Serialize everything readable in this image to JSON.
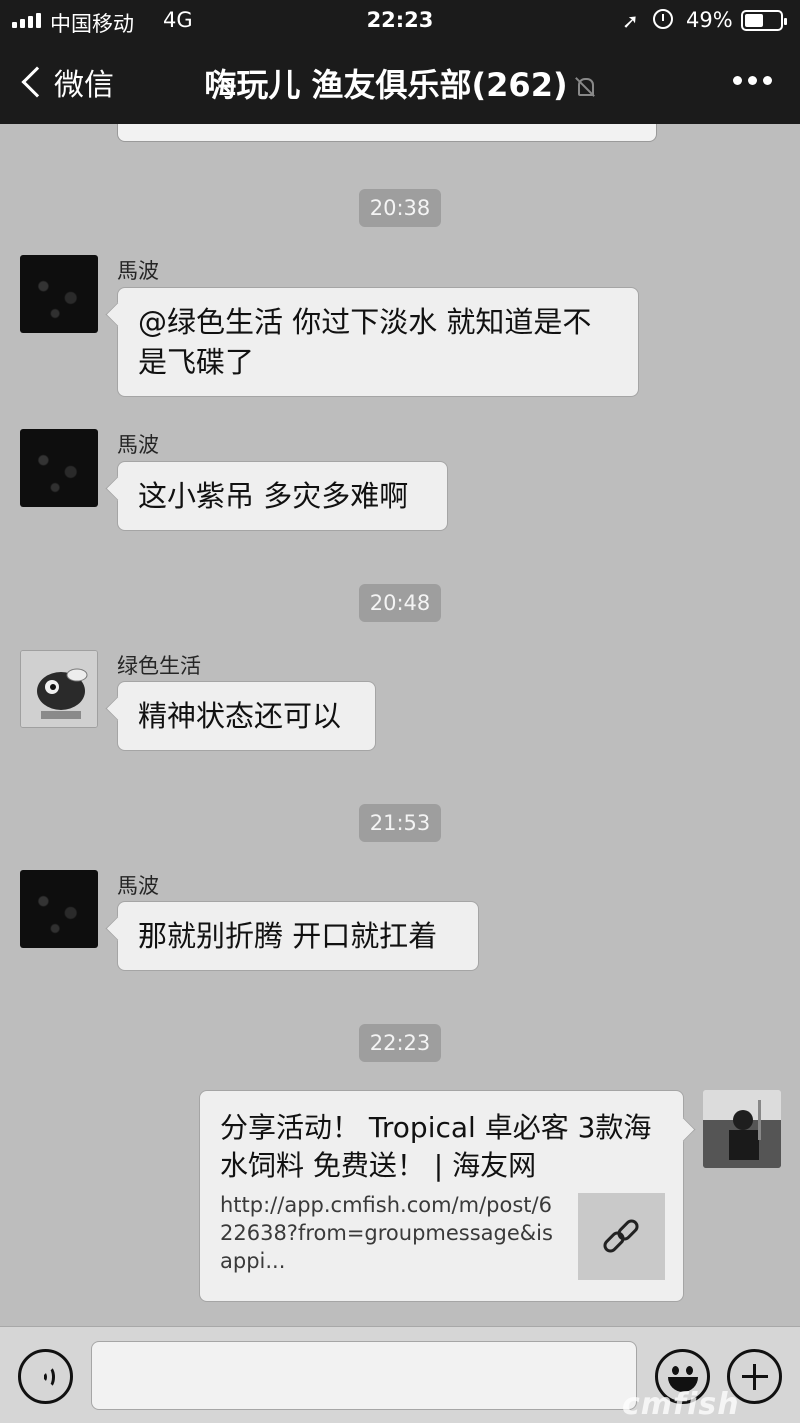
{
  "status_bar": {
    "carrier": "中国移动",
    "network": "4G",
    "time": "22:23",
    "battery": "49%"
  },
  "nav": {
    "back_label": "微信",
    "title": "嗨玩儿 渔友俱乐部(262)"
  },
  "chat": {
    "timestamps": [
      "20:38",
      "20:48",
      "21:53",
      "22:23"
    ],
    "messages": [
      {
        "sender": "馬波",
        "text": "@绿色生活 你过下淡水 就知道是不是飞碟了"
      },
      {
        "sender": "馬波",
        "text": "这小紫吊 多灾多难啊"
      },
      {
        "sender": "绿色生活",
        "text": "精神状态还可以"
      },
      {
        "sender": "馬波",
        "text": "那就别折腾 开口就扛着"
      }
    ],
    "link_card": {
      "title": "分享活动！ Tropical 卓必客 3款海水饲料 免费送！ | 海友网",
      "description": "http://app.cmfish.com/m/post/622638?from=groupmessage&isappi..."
    }
  },
  "watermark": "cmfish"
}
